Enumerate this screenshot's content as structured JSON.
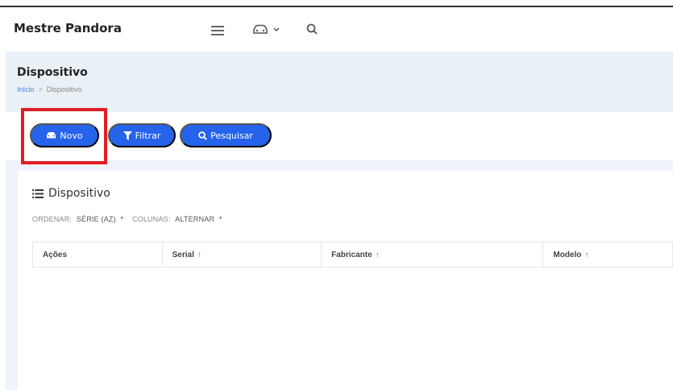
{
  "app": {
    "brand": "Mestre Pandora"
  },
  "nav": {
    "icons": [
      "menu-icon",
      "car-icon",
      "chevron-down-icon",
      "search-icon"
    ]
  },
  "page": {
    "title": "Dispositivo",
    "breadcrumb": {
      "home": "Início",
      "separator": ">",
      "current": "Dispositivo"
    }
  },
  "toolbar": {
    "novo_label": "Novo",
    "filtrar_label": "Filtrar",
    "pesquisar_label": "Pesquisar"
  },
  "card": {
    "title": "Dispositivo",
    "sort": {
      "order_label": "ORDENAR:",
      "order_value": "SÉRIE (AZ)",
      "columns_label": "COLUNAS:",
      "columns_value": "ALTERNAR",
      "marker": "*"
    }
  },
  "table": {
    "columns": [
      {
        "label": "Ações",
        "arrow": ""
      },
      {
        "label": "Serial",
        "arrow": "↑"
      },
      {
        "label": "Fabricante",
        "arrow": "↑"
      },
      {
        "label": "Modelo",
        "arrow": "↑"
      }
    ]
  },
  "colors": {
    "primary": "#2563eb",
    "highlight": "#e11d24",
    "page_bg": "#eef4f9"
  }
}
